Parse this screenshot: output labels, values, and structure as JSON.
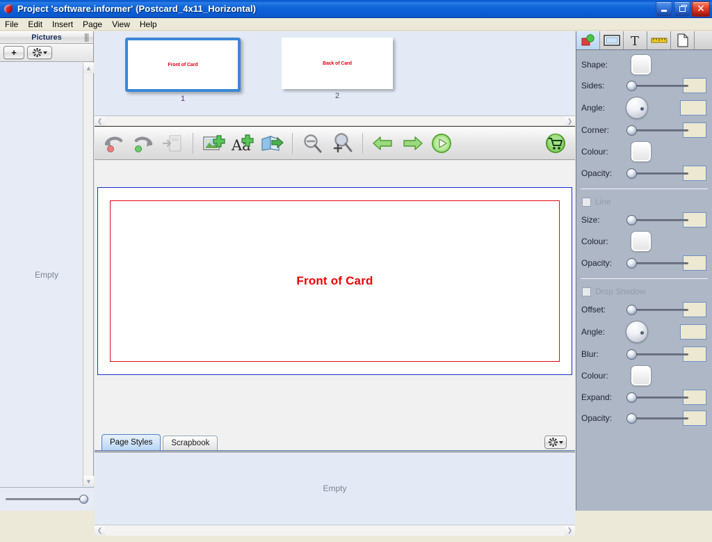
{
  "window": {
    "title": "Project 'software.informer' (Postcard_4x11_Horizontal)",
    "app_icon": "app-logo-icon",
    "minimize_label": "Minimize",
    "maximize_label": "Maximize",
    "close_label": "Close"
  },
  "menu": {
    "items": [
      "File",
      "Edit",
      "Insert",
      "Page",
      "View",
      "Help"
    ]
  },
  "pictures_panel": {
    "title": "Pictures",
    "add_label": "+",
    "options_label": "Options",
    "empty_text": "Empty",
    "zoom_slider_value": 100
  },
  "thumbnails": [
    {
      "number": "1",
      "caption": "Front of Card",
      "selected": true
    },
    {
      "number": "2",
      "caption": "Back of Card",
      "selected": false
    }
  ],
  "toolbar": {
    "buttons": [
      {
        "name": "undo-button",
        "title": "Undo"
      },
      {
        "name": "redo-button",
        "title": "Redo"
      },
      {
        "name": "save-button",
        "title": "Save",
        "disabled": true
      },
      {
        "name": "add-picture-button",
        "title": "Add Picture"
      },
      {
        "name": "add-text-button",
        "title": "Add Text"
      },
      {
        "name": "add-page-button",
        "title": "Add Page"
      },
      {
        "name": "zoom-out-button",
        "title": "Zoom Out"
      },
      {
        "name": "zoom-in-button",
        "title": "Zoom In"
      },
      {
        "name": "previous-page-button",
        "title": "Previous Page"
      },
      {
        "name": "next-page-button",
        "title": "Next Page"
      },
      {
        "name": "preview-button",
        "title": "Preview"
      },
      {
        "name": "buy-button",
        "title": "Buy"
      }
    ]
  },
  "canvas": {
    "page_text": "Front of Card",
    "page_border_colour": "#1531c4",
    "margin_guide_colour": "#e30613",
    "text_colour": "#f00000"
  },
  "bottom_tabs": {
    "tabs": [
      {
        "label": "Page Styles",
        "active": true
      },
      {
        "label": "Scrapbook",
        "active": false
      }
    ],
    "options_label": "Options",
    "empty_text": "Empty"
  },
  "properties": {
    "tabs": [
      {
        "name": "tab-shapes",
        "icon": "shapes-icon",
        "active": true
      },
      {
        "name": "tab-frame",
        "icon": "frame-icon",
        "active": false
      },
      {
        "name": "tab-text",
        "icon": "text-icon",
        "active": false
      },
      {
        "name": "tab-measure",
        "icon": "ruler-icon",
        "active": false
      },
      {
        "name": "tab-page",
        "icon": "page-icon",
        "active": false
      }
    ],
    "shape_section": {
      "rows": [
        {
          "label": "Shape:",
          "control": "swatch"
        },
        {
          "label": "Sides:",
          "control": "slider",
          "value": ""
        },
        {
          "label": "Angle:",
          "control": "dial",
          "value": ""
        },
        {
          "label": "Corner:",
          "control": "slider",
          "value": ""
        },
        {
          "label": "Colour:",
          "control": "swatch"
        },
        {
          "label": "Opacity:",
          "control": "slider",
          "value": ""
        }
      ]
    },
    "line_section": {
      "title": "Line",
      "checked": false,
      "enabled": false,
      "rows": [
        {
          "label": "Size:",
          "control": "slider",
          "value": ""
        },
        {
          "label": "Colour:",
          "control": "swatch"
        },
        {
          "label": "Opacity:",
          "control": "slider",
          "value": ""
        }
      ]
    },
    "shadow_section": {
      "title": "Drop Shadow",
      "checked": false,
      "enabled": false,
      "rows": [
        {
          "label": "Offset:",
          "control": "slider",
          "value": ""
        },
        {
          "label": "Angle:",
          "control": "dial",
          "value": ""
        },
        {
          "label": "Blur:",
          "control": "slider",
          "value": ""
        },
        {
          "label": "Colour:",
          "control": "swatch"
        },
        {
          "label": "Expand:",
          "control": "slider",
          "value": ""
        },
        {
          "label": "Opacity:",
          "control": "slider",
          "value": ""
        }
      ]
    }
  }
}
